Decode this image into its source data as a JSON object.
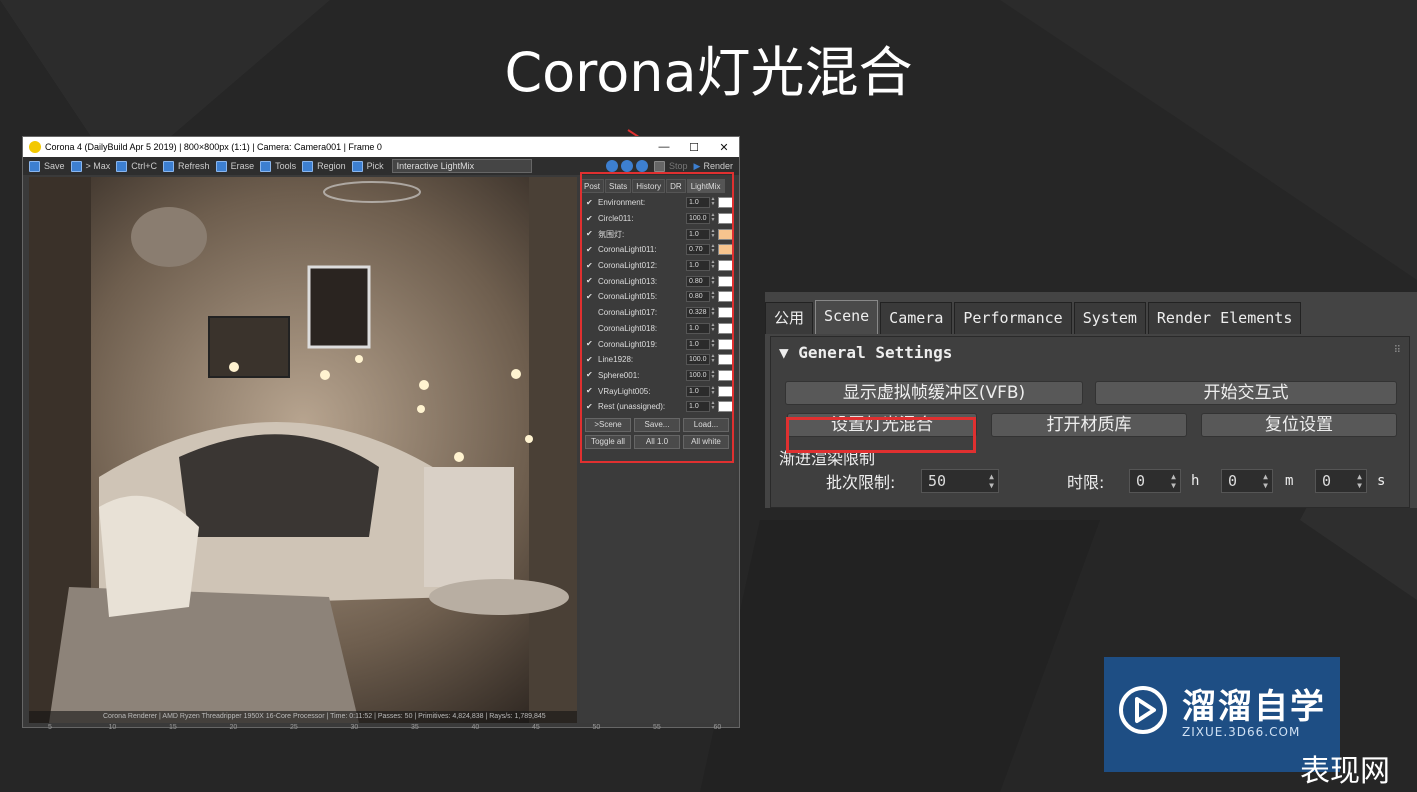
{
  "slide": {
    "title": "Corona灯光混合"
  },
  "vfb": {
    "title": "Corona 4 (DailyBuild Apr  5 2019) | 800×800px (1:1) | Camera: Camera001 | Frame 0",
    "window_buttons": [
      "—",
      "☐",
      "✕"
    ],
    "toolbar": {
      "save": "Save",
      "max": "> Max",
      "ctrlc": "Ctrl+C",
      "refresh": "Refresh",
      "erase": "Erase",
      "tools": "Tools",
      "region": "Region",
      "pick": "Pick",
      "mode": "Interactive LightMix",
      "stop": "Stop",
      "render": "Render"
    },
    "status": "Corona Renderer | AMD Ryzen Threadripper 1950X 16-Core Processor  | Time: 0:11:52 | Passes: 50 | Primitives: 4,824,838 | Rays/s: 1,789,845",
    "ruler": [
      "5",
      "10",
      "15",
      "20",
      "25",
      "30",
      "35",
      "40",
      "45",
      "50",
      "55",
      "60"
    ]
  },
  "lightmix": {
    "tabs": [
      "Post",
      "Stats",
      "History",
      "DR",
      "LightMix"
    ],
    "active_tab": "LightMix",
    "lights": [
      {
        "name": "Environment:",
        "value": "1.0",
        "checked": true,
        "color": "#ffffff"
      },
      {
        "name": "Circle011:",
        "value": "100.0",
        "checked": true,
        "color": "#ffffff"
      },
      {
        "name": "氛围灯:",
        "value": "1.0",
        "checked": true,
        "color": "#f7c48e"
      },
      {
        "name": "CoronaLight011:",
        "value": "0.70",
        "checked": true,
        "color": "#f7c48e"
      },
      {
        "name": "CoronaLight012:",
        "value": "1.0",
        "checked": true,
        "color": "#ffffff"
      },
      {
        "name": "CoronaLight013:",
        "value": "0.80",
        "checked": true,
        "color": "#ffffff"
      },
      {
        "name": "CoronaLight015:",
        "value": "0.80",
        "checked": true,
        "color": "#ffffff"
      },
      {
        "name": "CoronaLight017:",
        "value": "0.328",
        "checked": false,
        "color": "#ffffff"
      },
      {
        "name": "CoronaLight018:",
        "value": "1.0",
        "checked": false,
        "color": "#ffffff"
      },
      {
        "name": "CoronaLight019:",
        "value": "1.0",
        "checked": true,
        "color": "#ffffff"
      },
      {
        "name": "Line1928:",
        "value": "100.0",
        "checked": true,
        "color": "#ffffff"
      },
      {
        "name": "Sphere001:",
        "value": "100.0",
        "checked": true,
        "color": "#ffffff"
      },
      {
        "name": "VRayLight005:",
        "value": "1.0",
        "checked": true,
        "color": "#ffffff"
      },
      {
        "name": "Rest (unassigned):",
        "value": "1.0",
        "checked": true,
        "color": "#ffffff"
      }
    ],
    "buttons_row1": [
      ">Scene",
      "Save...",
      "Load..."
    ],
    "buttons_row2": [
      "Toggle all",
      "All 1.0",
      "All white"
    ]
  },
  "render_setup": {
    "tabs": [
      "公用",
      "Scene",
      "Camera",
      "Performance",
      "System",
      "Render Elements"
    ],
    "active_tab": "Scene",
    "group_title": "General Settings",
    "btn_vfb": "显示虚拟帧缓冲区(VFB)",
    "btn_interactive": "开始交互式",
    "btn_lightmix": "设置灯光混合",
    "btn_material": "打开材质库",
    "btn_reset": "复位设置",
    "progressive_label": "渐进渲染限制",
    "pass_label": "批次限制:",
    "pass_value": "50",
    "time_label": "时限:",
    "time_h": "0",
    "time_m": "0",
    "time_s": "0",
    "unit_h": "h",
    "unit_m": "m",
    "unit_s": "s"
  },
  "logo": {
    "cn": "溜溜自学",
    "en": "ZIXUE.3D66.COM"
  },
  "footer": "表现网",
  "colors": {
    "highlight": "#e03030",
    "logo_bg": "#1e4e84",
    "accent_blue": "#3d7fd0"
  }
}
